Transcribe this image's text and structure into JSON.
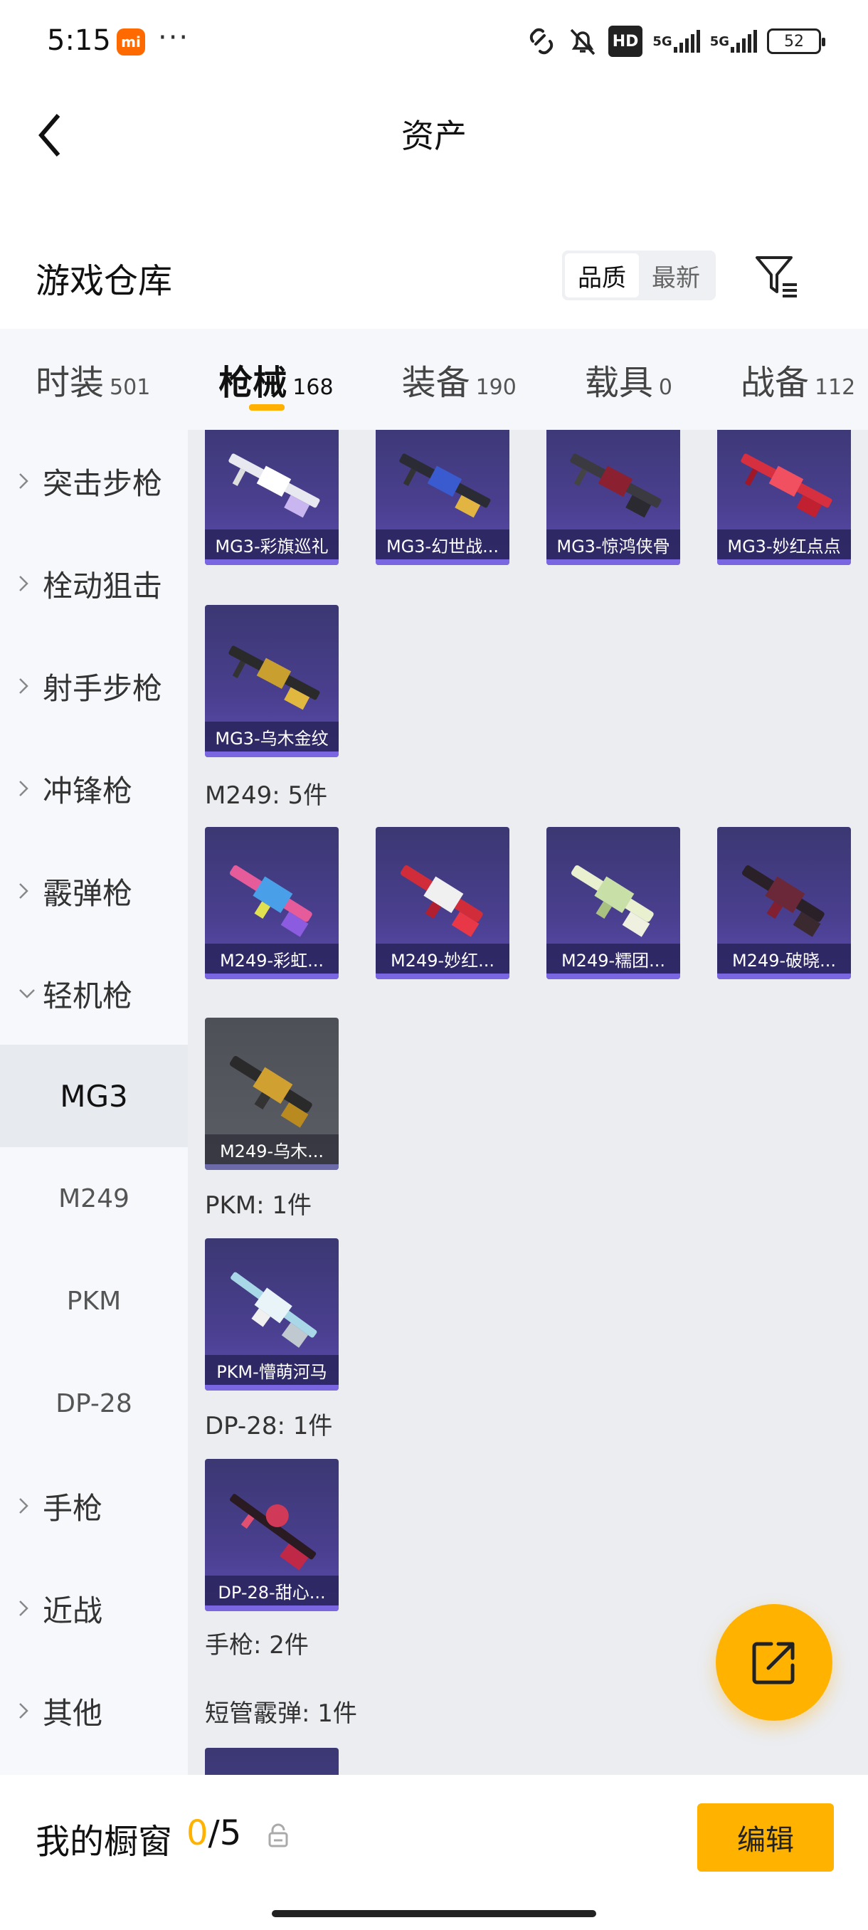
{
  "status_bar": {
    "time": "5:15",
    "app_badge": "mi",
    "more": "···",
    "hd": "HD",
    "net1": "5G",
    "net2": "5G",
    "battery": "52"
  },
  "header": {
    "title": "资产"
  },
  "warehouse": {
    "title": "游戏仓库",
    "sort_options": [
      "品质",
      "最新"
    ],
    "active_sort": "品质"
  },
  "tabs": [
    {
      "label": "时装",
      "count": "501"
    },
    {
      "label": "枪械",
      "count": "168",
      "active": true
    },
    {
      "label": "装备",
      "count": "190"
    },
    {
      "label": "载具",
      "count": "0"
    },
    {
      "label": "战备",
      "count": "112"
    }
  ],
  "sidebar": {
    "categories": [
      "突击步枪",
      "栓动狙击",
      "射手步枪",
      "冲锋枪",
      "霰弹枪",
      "轻机枪",
      "手枪",
      "近战",
      "其他"
    ],
    "expanded": "轻机枪",
    "subitems": [
      "MG3",
      "M249",
      "PKM",
      "DP-28"
    ],
    "active_sub": "MG3"
  },
  "content": {
    "mg3_items": [
      "MG3-彩旗巡礼",
      "MG3-幻世战...",
      "MG3-惊鸿侠骨",
      "MG3-妙红点点",
      "MG3-乌木金纹"
    ],
    "m249_label": "M249: 5件",
    "m249_items": [
      "M249-彩虹...",
      "M249-妙红...",
      "M249-糯团...",
      "M249-破晓...",
      "M249-乌木..."
    ],
    "pkm_label": "PKM: 1件",
    "pkm_items": [
      "PKM-懵萌河马"
    ],
    "dp28_label": "DP-28: 1件",
    "dp28_items": [
      "DP-28-甜心..."
    ],
    "pistol_label": "手枪: 2件",
    "shotgun_short_label": "短管霰弹: 1件"
  },
  "bottom_bar": {
    "label": "我的橱窗",
    "current": "0",
    "total": "/5",
    "edit": "编辑"
  },
  "colors": {
    "accent": "#ffb300",
    "card_purple": "#4a3f8f",
    "sidebar_bg": "#f6f8fb",
    "content_bg": "#ebedf1"
  }
}
